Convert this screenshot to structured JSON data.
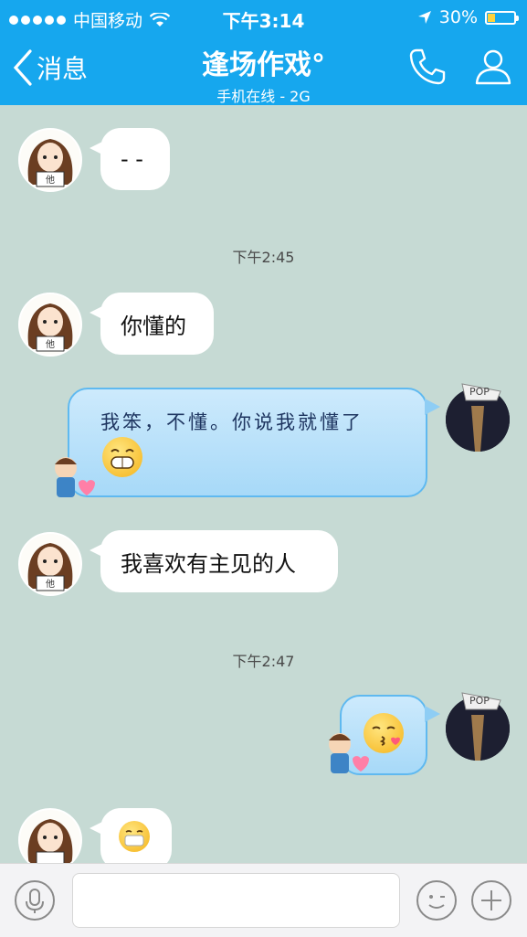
{
  "status_bar": {
    "carrier": "中国移动",
    "time": "下午3:14",
    "battery": "30%",
    "battery_level": 0.3
  },
  "header": {
    "back_label": "消息",
    "title": "逢场作戏°",
    "subtitle": "手机在线 - 2G"
  },
  "messages": [
    {
      "side": "in",
      "text": "- -"
    },
    {
      "type": "timestamp",
      "text": "下午2:45"
    },
    {
      "side": "in",
      "text": "你懂的"
    },
    {
      "side": "out",
      "text": "我笨，不懂。你说我就懂了",
      "emoji": "grin"
    },
    {
      "side": "in",
      "text": "我喜欢有主见的人"
    },
    {
      "type": "timestamp",
      "text": "下午2:47"
    },
    {
      "side": "out",
      "emoji": "kiss"
    },
    {
      "side": "in",
      "emoji": "mask"
    }
  ],
  "avatar_me_cap_text": "POP",
  "avatar_girl_sign_text": "他",
  "colors": {
    "header": "#16a7ee",
    "chat_bg": "#c6dad4",
    "bubble_out": "#a7d9f8"
  }
}
